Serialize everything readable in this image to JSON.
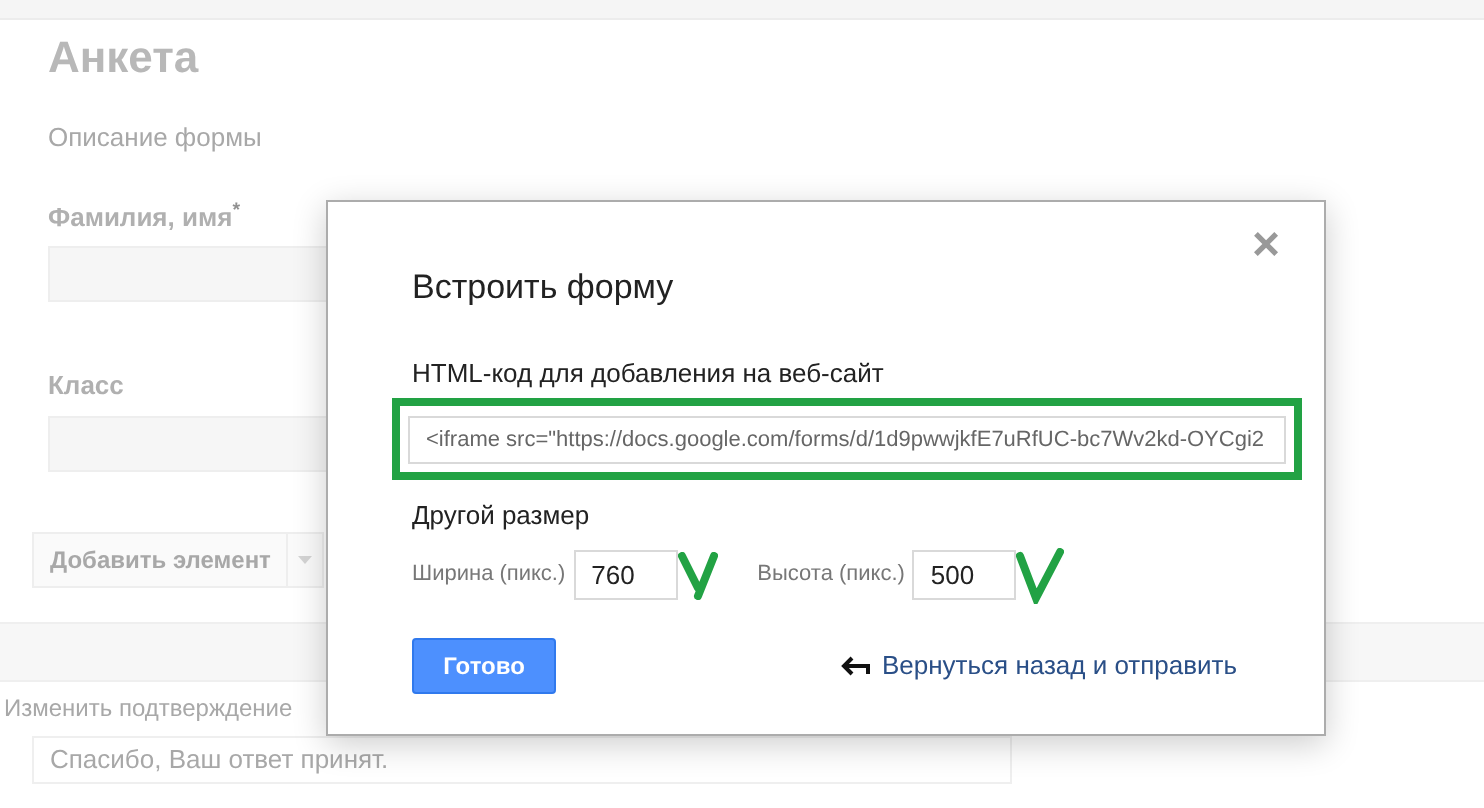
{
  "form": {
    "title": "Анкета",
    "description_placeholder": "Описание формы",
    "questions": [
      {
        "label": "Фамилия, имя",
        "required_mark": "*"
      },
      {
        "label": "Класс"
      }
    ],
    "add_button": "Добавить элемент",
    "confirmation_label": "Изменить подтверждение",
    "confirmation_placeholder": "Спасибо, Ваш ответ принят."
  },
  "dialog": {
    "title": "Встроить форму",
    "close": "×",
    "code_label": "HTML-код для добавления на веб-сайт",
    "code_value": "<iframe src=\"https://docs.google.com/forms/d/1d9pwwjkfE7uRfUC-bc7Wv2kd-OYCgi2",
    "size_heading": "Другой размер",
    "width_label": "Ширина (пикс.)",
    "width_value": "760",
    "height_label": "Высота (пикс.)",
    "height_value": "500",
    "done_button": "Готово",
    "back_link": "Вернуться назад и отправить"
  }
}
